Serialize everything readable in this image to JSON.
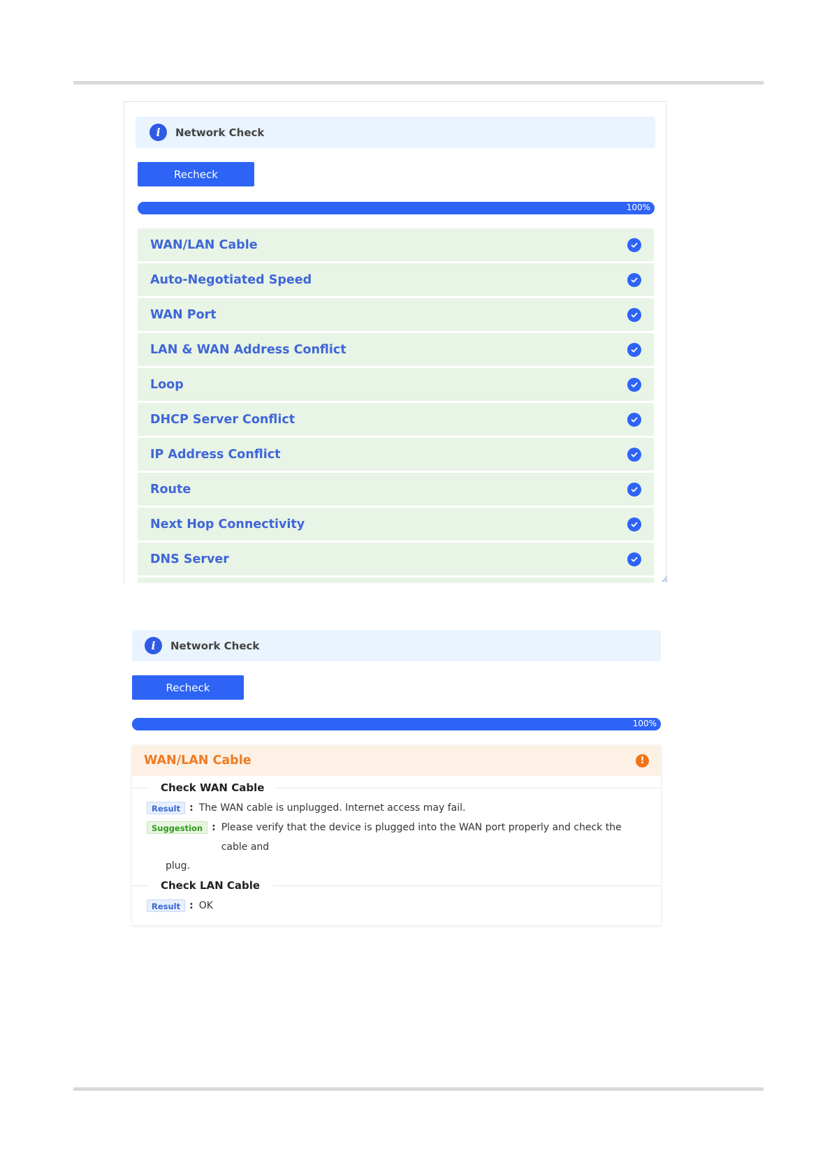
{
  "panel1": {
    "info_title": "Network Check",
    "recheck_label": "Recheck",
    "progress": {
      "value": 100,
      "label": "100%"
    },
    "checks": [
      {
        "label": "WAN/LAN Cable",
        "status": "ok"
      },
      {
        "label": "Auto-Negotiated Speed",
        "status": "ok"
      },
      {
        "label": "WAN Port",
        "status": "ok"
      },
      {
        "label": "LAN & WAN Address Conflict",
        "status": "ok"
      },
      {
        "label": "Loop",
        "status": "ok"
      },
      {
        "label": "DHCP Server Conflict",
        "status": "ok"
      },
      {
        "label": "IP Address Conflict",
        "status": "ok"
      },
      {
        "label": "Route",
        "status": "ok"
      },
      {
        "label": "Next Hop Connectivity",
        "status": "ok"
      },
      {
        "label": "DNS Server",
        "status": "ok"
      }
    ]
  },
  "panel2": {
    "info_title": "Network Check",
    "recheck_label": "Recheck",
    "progress": {
      "value": 100,
      "label": "100%"
    },
    "detail": {
      "title": "WAN/LAN Cable",
      "status": "warning",
      "sections": {
        "wan": {
          "title": "Check WAN Cable",
          "result_tag": "Result",
          "result_text": "The WAN cable is unplugged. Internet access may fail.",
          "suggestion_tag": "Suggestion",
          "suggestion_text": "Please verify that the device is plugged into the WAN port properly and check the cable and",
          "suggestion_text_cont": "plug."
        },
        "lan": {
          "title": "Check LAN Cable",
          "result_tag": "Result",
          "result_text": "OK"
        }
      }
    }
  },
  "colors": {
    "primary": "#2e64f5",
    "ok_bg": "#e8f4e6",
    "info_bg": "#eaf4fe",
    "warning": "#f37316",
    "warning_bg": "#fdf0e5"
  }
}
